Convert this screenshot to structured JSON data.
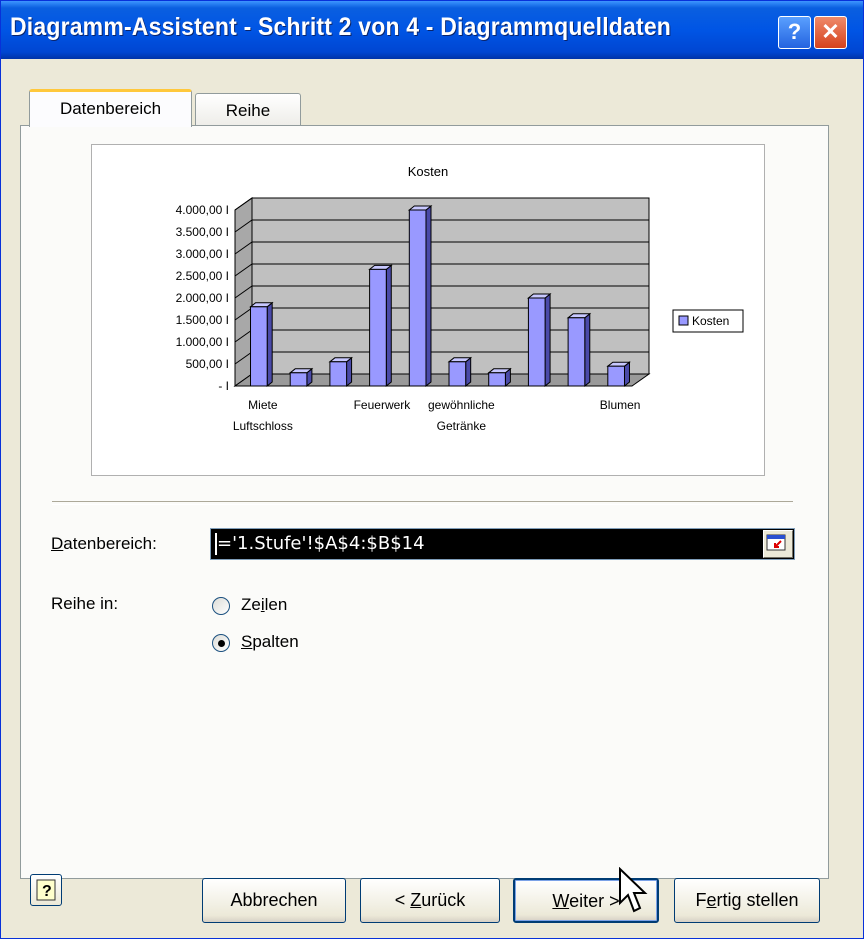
{
  "window": {
    "title": "Diagramm-Assistent - Schritt 2 von 4 - Diagrammquelldaten",
    "help_glyph": "?",
    "close_glyph": "✕"
  },
  "tabs": [
    {
      "label": "Datenbereich",
      "active": true
    },
    {
      "label": "Reihe",
      "active": false
    }
  ],
  "chart_data": {
    "type": "bar",
    "title": "Kosten",
    "categories": [
      "Miete Luftschloss",
      "",
      "",
      "Feuerwerk",
      "",
      "gewöhnliche Getränke",
      "",
      "",
      "",
      "Blumen",
      ""
    ],
    "x_tick_labels": [
      {
        "lines": [
          "Miete",
          "Luftschloss"
        ],
        "index": 0
      },
      {
        "lines": [
          "Feuerwerk"
        ],
        "index": 3
      },
      {
        "lines": [
          "gewöhnliche",
          "Getränke"
        ],
        "index": 5
      },
      {
        "lines": [
          "Blumen"
        ],
        "index": 9
      }
    ],
    "series": [
      {
        "name": "Kosten",
        "values": [
          1800,
          300,
          550,
          2650,
          4000,
          550,
          300,
          2000,
          1550,
          450
        ]
      }
    ],
    "y_ticks": [
      "4.000,00 I",
      "3.500,00 I",
      "3.000,00 I",
      "2.500,00 I",
      "2.000,00 I",
      "1.500,00 I",
      "1.000,00 I",
      "500,00 I",
      "- I"
    ],
    "ylim": [
      0,
      4000
    ],
    "legend": "right",
    "grid": true,
    "colors": {
      "bar": "#9999ff",
      "wall": "#c0c0c0"
    }
  },
  "source": {
    "range_label_u": "D",
    "range_label_rest": "atenbereich:",
    "range_value": "='1.Stufe'!$A$4:$B$14",
    "series_in_label": "Reihe in:",
    "rows_pre": "Ze",
    "rows_u": "i",
    "rows_post": "len",
    "cols_u": "S",
    "cols_post": "palten",
    "selected": "Spalten"
  },
  "buttons": {
    "cancel": "Abbrechen",
    "back_pre": "< ",
    "back_u": "Z",
    "back_post": "urück",
    "next_u": "W",
    "next_post": "eiter >",
    "finish_pre": "F",
    "finish_u": "e",
    "finish_post": "rtig stellen"
  },
  "icons": [
    "help-icon",
    "close-icon",
    "collapse-dialog-icon",
    "help-book-icon",
    "mouse-cursor-icon"
  ]
}
